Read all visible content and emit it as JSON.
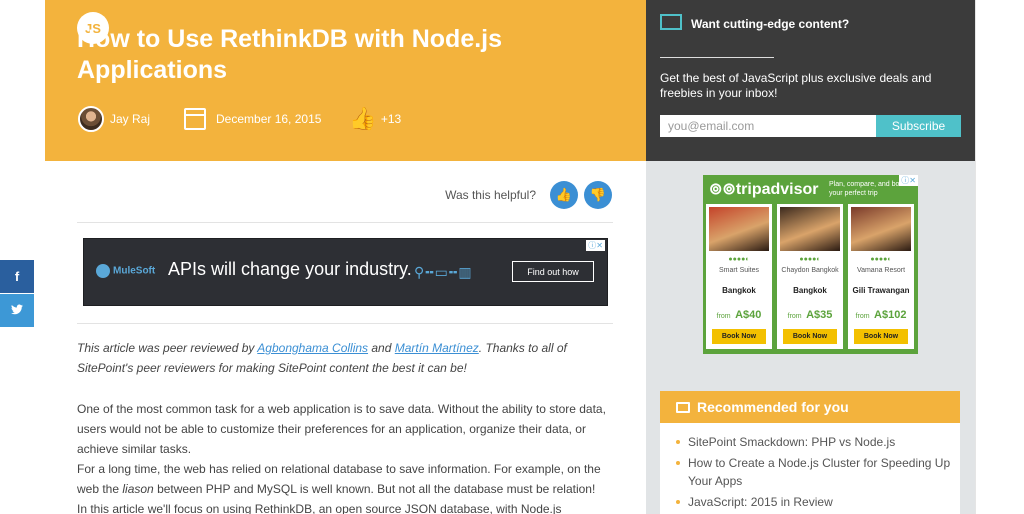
{
  "hero": {
    "badge": "JS",
    "title": "How to Use RethinkDB with Node.js Applications",
    "author": "Jay Raj",
    "date": "December 16, 2015",
    "likes": "+13"
  },
  "feedback": {
    "prompt": "Was this helpful?"
  },
  "top_ad": {
    "brand": "MuleSoft",
    "headline": "APIs will change your industry.",
    "cta": "Find out how"
  },
  "article": {
    "intro_prefix": "This article was peer reviewed by ",
    "reviewer_1": "Agbonghama Collins",
    "intro_middle": " and ",
    "reviewer_2": "Martín Martínez",
    "intro_suffix": ". Thanks to all of SitePoint's peer reviewers for making SitePoint content the best it can be!",
    "paragraph_1": "One of the most common task for a web application is to save data. Without the ability to store data, users would not be able to customize their preferences for an application, organize their data, or achieve similar tasks.",
    "paragraph_2_a": "For a long time, the web has relied on relational database to save information. For example, on the web the ",
    "paragraph_2_em": "liason",
    "paragraph_2_b": " between PHP and MySQL is well known. But not all the database must be relation!",
    "paragraph_3": "In this article we'll focus on using RethinkDB, an open source JSON database, with Node.js applications."
  },
  "share": {
    "facebook": "f",
    "twitter": "🐦"
  },
  "newsletter": {
    "title": "Want cutting-edge content?",
    "text": "Get the best of JavaScript plus exclusive deals and freebies in your inbox!",
    "email_placeholder": "you@email.com",
    "subscribe": "Subscribe"
  },
  "tripadvisor_ad": {
    "brand": "tripadvisor",
    "tagline": "Plan, compare, and book your perfect trip",
    "hotels": [
      {
        "name": "Smart Suites",
        "city": "Bangkok",
        "from": "from",
        "price": "A$40",
        "cta": "Book Now",
        "photo_color": "#c4432a"
      },
      {
        "name": "Chaydon Bangkok",
        "city": "Bangkok",
        "from": "from",
        "price": "A$35",
        "cta": "Book Now",
        "photo_color": "#3c2a1e"
      },
      {
        "name": "Vamana Resort",
        "city": "Gili Trawangan",
        "from": "from",
        "price": "A$102",
        "cta": "Book Now",
        "photo_color": "#7a3a2a"
      }
    ]
  },
  "recommended": {
    "title": "Recommended for you",
    "items": [
      "SitePoint Smackdown: PHP vs Node.js",
      "How to Create a Node.js Cluster for Speeding Up Your Apps",
      "JavaScript: 2015 in Review"
    ]
  },
  "colors": {
    "accent_yellow": "#f3b33d",
    "teal": "#4fc1c9",
    "link_blue": "#3b8fd4",
    "tripadvisor_green": "#5ca33c"
  }
}
